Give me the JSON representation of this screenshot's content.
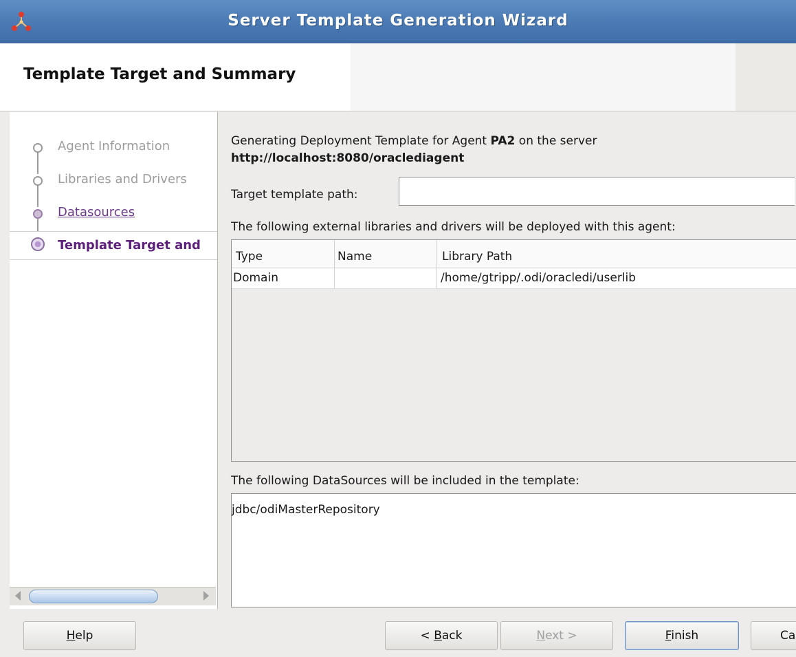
{
  "window": {
    "title": "Server Template Generation Wizard"
  },
  "header": {
    "page_title": "Template Target and Summary"
  },
  "nav": {
    "items": [
      {
        "label": "Agent Information",
        "state": "done"
      },
      {
        "label": "Libraries and Drivers",
        "state": "done"
      },
      {
        "label": "Datasources",
        "state": "visited"
      },
      {
        "label": "Template Target and",
        "state": "current"
      }
    ]
  },
  "summary": {
    "line1_prefix": "Generating Deployment Template for Agent ",
    "agent_name": "PA2",
    "line1_suffix": " on the server",
    "server_url": "http://localhost:8080/oraclediagent",
    "target_path_label": "Target template path:",
    "target_path_value": "",
    "libraries_label": "The following external libraries and drivers will be deployed with this agent:",
    "library_columns": [
      "Type",
      "Name",
      "Library Path"
    ],
    "libraries": [
      {
        "type": "Domain",
        "name": "",
        "path": "/home/gtripp/.odi/oracledi/userlib"
      }
    ],
    "datasources_label": "The following DataSources will be included in the template:",
    "datasources": [
      "jdbc/odiMasterRepository"
    ]
  },
  "buttons": {
    "help": {
      "mnemonic": "H",
      "rest": "elp"
    },
    "back": {
      "prefix": "< ",
      "mnemonic": "B",
      "rest": "ack"
    },
    "next": {
      "mnemonic": "N",
      "rest": "ext >"
    },
    "finish": {
      "mnemonic": "F",
      "rest": "inish"
    },
    "cancel": {
      "text": "Ca"
    }
  },
  "colors": {
    "titlebar": "#4a79b3",
    "current_step": "#5b1e7a",
    "visited_link": "#6b3b8a"
  }
}
